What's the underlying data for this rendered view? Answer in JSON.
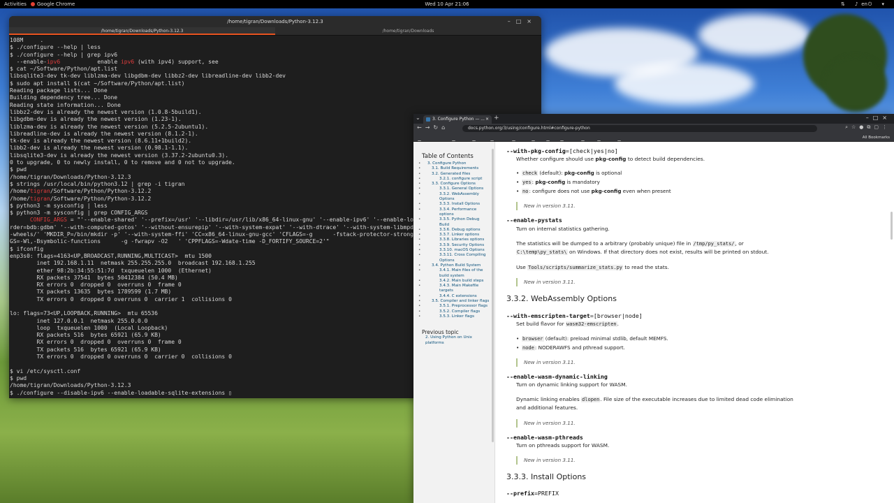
{
  "topbar": {
    "activities": "Activities",
    "app": "Google Chrome",
    "clock": "Wed 10 Apr  21:06",
    "lang": "en",
    "tray": "⇅ ♪ ⏻ ▾"
  },
  "terminal": {
    "title": "/home/tigran/Downloads/Python-3.12.3",
    "tabs": [
      "/home/tigran/Downloads/Python-3.12.3",
      "/home/tigran/Downloads"
    ],
    "lines": [
      {
        "t": "108M     ."
      },
      {
        "t": "$ ./configure --help | less"
      },
      {
        "t": "$ ./configure --help | grep ipv6"
      },
      {
        "a": "  --enable-",
        "h": "ipv6",
        "b": "           enable ",
        "h2": "ipv6",
        "c": " (with ipv4) support, see"
      },
      {
        "t": "$ cat ~/Software/Python/apt.list"
      },
      {
        "t": "libsqlite3-dev tk-dev liblzma-dev libgdbm-dev libbz2-dev libreadline-dev libb2-dev"
      },
      {
        "t": "$ sudo apt install $(cat ~/Software/Python/apt.list)"
      },
      {
        "t": "Reading package lists... Done"
      },
      {
        "t": "Building dependency tree... Done"
      },
      {
        "t": "Reading state information... Done"
      },
      {
        "t": "libbz2-dev is already the newest version (1.0.8-5build1)."
      },
      {
        "t": "libgdbm-dev is already the newest version (1.23-1)."
      },
      {
        "t": "liblzma-dev is already the newest version (5.2.5-2ubuntu1)."
      },
      {
        "t": "libreadline-dev is already the newest version (8.1.2-1)."
      },
      {
        "t": "tk-dev is already the newest version (8.6.11+1build2)."
      },
      {
        "t": "libb2-dev is already the newest version (0.98.1-1.1)."
      },
      {
        "t": "libsqlite3-dev is already the newest version (3.37.2-2ubuntu0.3)."
      },
      {
        "t": "0 to upgrade, 0 to newly install, 0 to remove and 0 not to upgrade."
      },
      {
        "t": "$ pwd"
      },
      {
        "t": "/home/tigran/Downloads/Python-3.12.3"
      },
      {
        "t": "$ strings /usr/local/bin/python3.12 | grep -i tigran"
      },
      {
        "a": "/home/",
        "h": "tigran",
        "c": "/Software/Python/Python-3.12.2"
      },
      {
        "a": "/home/",
        "h": "tigran",
        "c": "/Software/Python/Python-3.12.2"
      },
      {
        "t": "$ python3 -m sysconfig | less"
      },
      {
        "t": "$ python3 -m sysconfig | grep CONFIG_ARGS"
      },
      {
        "a": "      ",
        "h": "CONFIG_ARGS",
        "c": " = \"'--enable-shared' '--prefix=/usr' '--libdir=/usr/lib/x86_64-linux-gnu' '--enable-ipv6' '--enable-loadable-sqlite-extensions' '--with-dbmliborder=bdb:gdbm'"
      },
      {
        "t": "rder=bdb:gdbm' '--with-computed-gotos' '--without-ensurepip' '--with-system-expat' '--with-dtrace' '--with-system-libmpdec' '--with-wheel-pkg-dir=/usr/share/python-wheels/'"
      },
      {
        "t": "-wheels/' 'MKDIR_P=/bin/mkdir -p' '--with-system-ffi' 'CC=x86_64-linux-gnu-gcc' 'CFLAGS=-g      -fstack-protector-strong -Wformat -Werror=format-security'"
      },
      {
        "t": "GS=-Wl,-Bsymbolic-functions      -g -fwrapv -O2   ' 'CPPFLAGS=-Wdate-time -D_FORTIFY_SOURCE=2'\""
      },
      {
        "t": "$ ifconfig"
      },
      {
        "t": "enp3s0: flags=4163<UP,BROADCAST,RUNNING,MULTICAST>  mtu 1500"
      },
      {
        "t": "        inet 192.168.1.11  netmask 255.255.255.0  broadcast 192.168.1.255"
      },
      {
        "t": "        ether 98:2b:34:55:51:7d  txqueuelen 1000  (Ethernet)"
      },
      {
        "t": "        RX packets 37541  bytes 50412384 (50.4 MB)"
      },
      {
        "t": "        RX errors 0  dropped 0  overruns 0  frame 0"
      },
      {
        "t": "        TX packets 13635  bytes 1789599 (1.7 MB)"
      },
      {
        "t": "        TX errors 0  dropped 0 overruns 0  carrier 1  collisions 0"
      },
      {
        "t": ""
      },
      {
        "t": "lo: flags=73<UP,LOOPBACK,RUNNING>  mtu 65536"
      },
      {
        "t": "        inet 127.0.0.1  netmask 255.0.0.0"
      },
      {
        "t": "        loop  txqueuelen 1000  (Local Loopback)"
      },
      {
        "t": "        RX packets 516  bytes 65921 (65.9 KB)"
      },
      {
        "t": "        RX errors 0  dropped 0  overruns 0  frame 0"
      },
      {
        "t": "        TX packets 516  bytes 65921 (65.9 KB)"
      },
      {
        "t": "        TX errors 0  dropped 0 overruns 0  carrier 0  collisions 0"
      },
      {
        "t": ""
      },
      {
        "t": "$ vi /etc/sysctl.conf"
      },
      {
        "t": "$ pwd"
      },
      {
        "t": "/home/tigran/Downloads/Python-3.12.3"
      },
      {
        "t": "$ ./configure --disable-ipv6 --enable-loadable-sqlite-extensions ▯"
      }
    ]
  },
  "chrome": {
    "tab_title": "3. Configure Python — ...",
    "url": "docs.python.org/3/using/configure.html#configure-python",
    "bookmarks": [
      "Bibles.org.uk",
      "Banks",
      "Tech",
      "LOCAL",
      "Music",
      "UB",
      "UL",
      "T450s",
      "p70",
      "NATO",
      "PY"
    ],
    "all_bookmarks": "All Bookmarks",
    "sidebar": {
      "heading": "Table of Contents",
      "toc": [
        {
          "lvl": 1,
          "text": "3. Configure Python"
        },
        {
          "lvl": 2,
          "text": "3.1. Build Requirements"
        },
        {
          "lvl": 2,
          "text": "3.2. Generated files"
        },
        {
          "lvl": 3,
          "text": "3.2.1. configure script"
        },
        {
          "lvl": 2,
          "text": "3.3. Configure Options"
        },
        {
          "lvl": 3,
          "text": "3.3.1. General Options"
        },
        {
          "lvl": 3,
          "text": "3.3.2. WebAssembly Options"
        },
        {
          "lvl": 3,
          "text": "3.3.3. Install Options"
        },
        {
          "lvl": 3,
          "text": "3.3.4. Performance options"
        },
        {
          "lvl": 3,
          "text": "3.3.5. Python Debug Build"
        },
        {
          "lvl": 3,
          "text": "3.3.6. Debug options"
        },
        {
          "lvl": 3,
          "text": "3.3.7. Linker options"
        },
        {
          "lvl": 3,
          "text": "3.3.8. Libraries options"
        },
        {
          "lvl": 3,
          "text": "3.3.9. Security Options"
        },
        {
          "lvl": 3,
          "text": "3.3.10. macOS Options"
        },
        {
          "lvl": 3,
          "text": "3.3.11. Cross Compiling Options"
        },
        {
          "lvl": 2,
          "text": "3.4. Python Build System"
        },
        {
          "lvl": 3,
          "text": "3.4.1. Main files of the build system"
        },
        {
          "lvl": 3,
          "text": "3.4.2. Main build steps"
        },
        {
          "lvl": 3,
          "text": "3.4.3. Main Makefile targets"
        },
        {
          "lvl": 3,
          "text": "3.4.4. C extensions"
        },
        {
          "lvl": 2,
          "text": "3.5. Compiler and linker flags"
        },
        {
          "lvl": 3,
          "text": "3.5.1. Preprocessor flags"
        },
        {
          "lvl": 3,
          "text": "3.5.2. Compiler flags"
        },
        {
          "lvl": 3,
          "text": "3.5.3. Linker flags"
        }
      ],
      "prev_heading": "Previous topic",
      "prev_link": "2. Using Python on Unix platforms"
    },
    "main": {
      "opt_pkg_config": "--with-pkg-config",
      "opt_pkg_config_arg": "=[check|yes|no]",
      "pkg_desc_a": "Whether configure should use ",
      "pkg_desc_b": "pkg-config",
      "pkg_desc_c": " to detect build dependencies.",
      "pkg_li1_code": "check",
      "pkg_li1_a": " (default): ",
      "pkg_li1_b": "pkg-config",
      "pkg_li1_c": " is optional",
      "pkg_li2_code": "yes",
      "pkg_li2_a": ": ",
      "pkg_li2_b": "pkg-config",
      "pkg_li2_c": " is mandatory",
      "pkg_li3_code": "no",
      "pkg_li3_a": ": configure does not use ",
      "pkg_li3_b": "pkg-config",
      "pkg_li3_c": " even when present",
      "new_311": "New in version 3.11.",
      "opt_pystats": "--enable-pystats",
      "pystats_desc": "Turn on internal statistics gathering.",
      "pystats_p2a": "The statistics will be dumped to a arbitrary (probably unique) file in ",
      "pystats_p2code": "/tmp/py_stats/",
      "pystats_p2b": ", or",
      "pystats_p2code2": "C:\\temp\\py_stats\\",
      "pystats_p2c": " on Windows. If that directory does not exist, results will be printed on stdout.",
      "pystats_p3a": "Use ",
      "pystats_p3code": "Tools/scripts/summarize_stats.py",
      "pystats_p3b": " to read the stats.",
      "h_wasm": "3.3.2. WebAssembly Options",
      "opt_emscripten": "--with-emscripten-target",
      "opt_emscripten_arg": "=[browser|node]",
      "ems_desc_a": "Set build flavor for ",
      "ems_desc_code": "wasm32-emscripten",
      "ems_desc_b": ".",
      "ems_li1_code": "browser",
      "ems_li1_text": " (default): preload minimal stdlib, default MEMFS.",
      "ems_li2_code": "node",
      "ems_li2_text": ": NODERAWFS and pthread support.",
      "opt_wasm_dyn": "--enable-wasm-dynamic-linking",
      "wasm_dyn_desc": "Turn on dynamic linking support for WASM.",
      "wasm_dyn_p2a": "Dynamic linking enables ",
      "wasm_dyn_p2code": "dlopen",
      "wasm_dyn_p2b": ". File size of the executable increases due to limited dead code elimination",
      "wasm_dyn_p2c": "and additional features.",
      "opt_wasm_pthreads": "--enable-wasm-pthreads",
      "wasm_pthreads_desc": "Turn on pthreads support for WASM.",
      "h_install": "3.3.3. Install Options",
      "opt_prefix": "--prefix",
      "opt_prefix_arg": "=PREFIX"
    }
  }
}
